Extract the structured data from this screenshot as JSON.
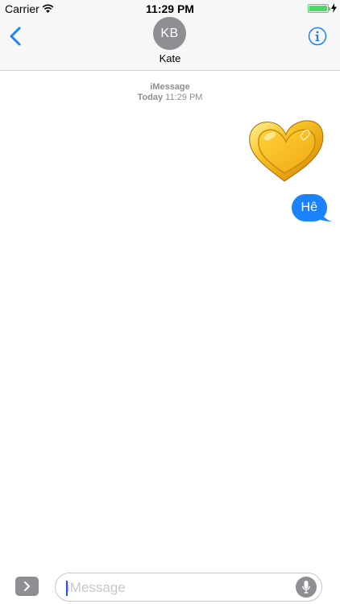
{
  "status_bar": {
    "carrier": "Carrier",
    "time": "11:29 PM",
    "battery_level": 1.0
  },
  "header": {
    "avatar_initials": "KB",
    "contact_name": "Kate",
    "back_icon": "chevron-left-icon",
    "info_icon": "info-circle-icon"
  },
  "conversation": {
    "service": "iMessage",
    "day": "Today",
    "time": "11:29 PM",
    "messages": [
      {
        "type": "sticker",
        "sticker": "gold-heart",
        "sender": "me"
      },
      {
        "type": "text",
        "text": "Hê",
        "sender": "me"
      }
    ]
  },
  "composer": {
    "placeholder": "iMessage",
    "apps_icon": "chevron-right-icon",
    "mic_icon": "microphone-icon"
  },
  "colors": {
    "accent": "#1b82fa",
    "battery": "#4cd964",
    "avatar_bg": "#8e8e93",
    "meta_text": "#8e8e93"
  }
}
